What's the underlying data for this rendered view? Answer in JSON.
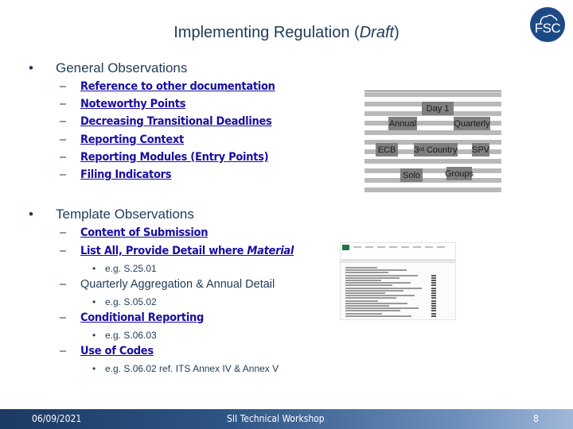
{
  "slide": {
    "title_main": "Implementing Regulation (",
    "title_italic": "Draft",
    "title_end": ")",
    "logo_text": "FSC"
  },
  "general": {
    "bullet": "•",
    "heading": "General Observations",
    "dash": "–",
    "items": [
      {
        "label": "Reference to other documentation"
      },
      {
        "label": "Noteworthy Points"
      },
      {
        "label": "Decreasing Transitional Deadlines"
      },
      {
        "label": "Reporting Context"
      },
      {
        "label": "Reporting Modules (Entry Points)"
      },
      {
        "label": "Filing Indicators"
      }
    ]
  },
  "template": {
    "bullet": "•",
    "heading": "Template Observations",
    "dash": "–",
    "subbullet": "•",
    "content_submission": "Content of Submission",
    "list_all": "List All, Provide Detail where ",
    "list_all_italic": "Material",
    "ex1": "e.g. S.25.01",
    "quarterly": "Quarterly Aggregation & Annual Detail",
    "ex2": "e.g. S.05.02",
    "conditional": "Conditional Reporting",
    "ex3": "e.g. S.06.03",
    "codes": "Use of Codes",
    "ex4": "e.g. S.06.02 ref. ITS Annex IV & Annex V"
  },
  "table_image": {
    "overlays": {
      "day1": "Day 1",
      "annual": "Annual",
      "quarterly": "Quarterly",
      "ecb": "ECB",
      "third_country": "3rd Country",
      "spv": "SPV",
      "solo": "Solo",
      "groups": "Groups"
    },
    "overlay_color": "#7a7a7a"
  },
  "footer": {
    "date": "06/09/2021",
    "event": "SII Technical Workshop",
    "page": "8"
  }
}
